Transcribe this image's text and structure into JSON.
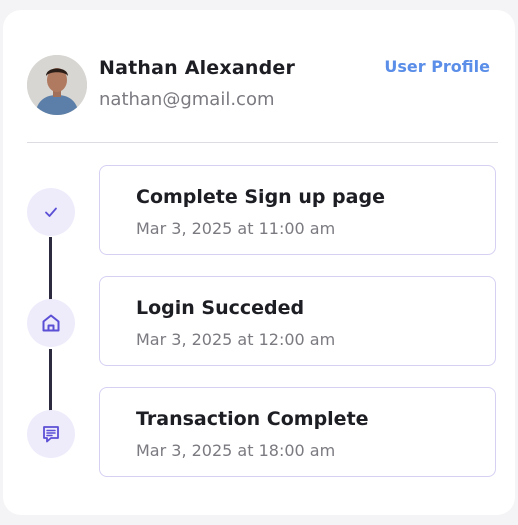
{
  "user": {
    "name": "Nathan Alexander",
    "email": "nathan@gmail.com",
    "profile_link": "User Profile"
  },
  "timeline": [
    {
      "icon": "check-icon",
      "title": "Complete Sign up page",
      "time": "Mar 3, 2025 at 11:00 am"
    },
    {
      "icon": "home-icon",
      "title": "Login Succeded",
      "time": "Mar 3, 2025 at 12:00 am"
    },
    {
      "icon": "receipt-icon",
      "title": "Transaction Complete",
      "time": "Mar 3, 2025 at 18:00 am"
    }
  ],
  "colors": {
    "accent": "#5a8ee8",
    "icon": "#5b4fd6",
    "node_bg": "#eeecfb",
    "card_border": "#d6d0f3",
    "connector": "#2c2a3e"
  }
}
